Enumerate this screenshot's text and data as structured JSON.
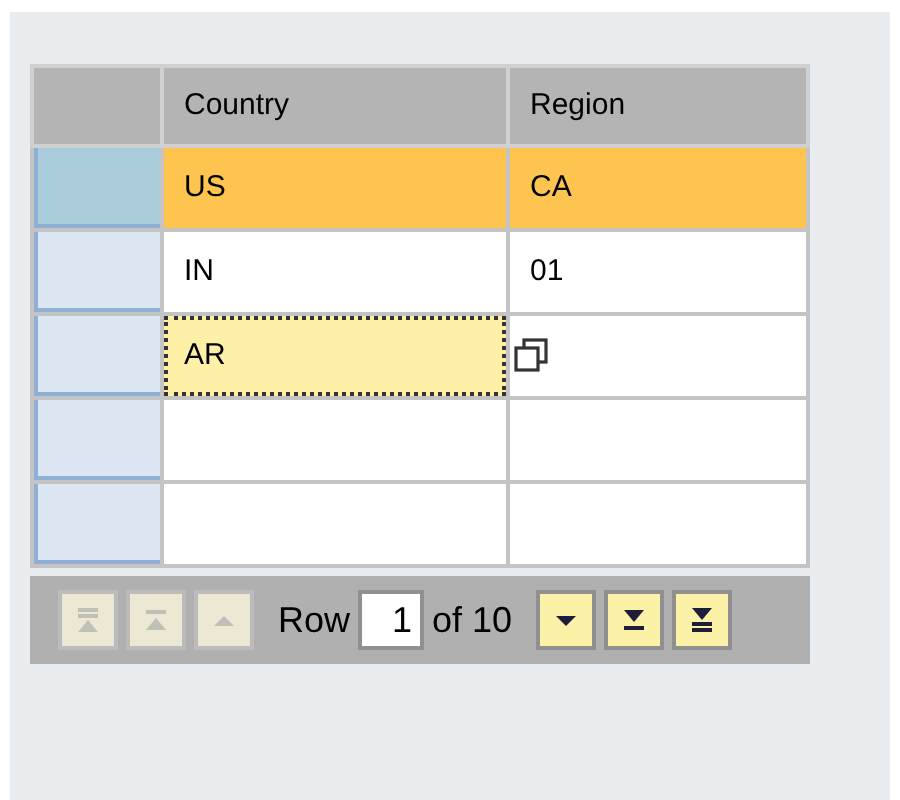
{
  "table": {
    "columns": [
      "Country",
      "Region"
    ],
    "rows": [
      {
        "selected": true,
        "country": "US",
        "region": "CA"
      },
      {
        "selected": false,
        "country": "IN",
        "region": "01"
      },
      {
        "selected": false,
        "country": "AR",
        "country_focused": true,
        "region_value_help": true
      },
      {
        "selected": false
      },
      {
        "selected": false
      }
    ]
  },
  "pager": {
    "label": "Row",
    "value": "1",
    "total": "of 10",
    "buttons": [
      {
        "kind": "first",
        "disabled": true
      },
      {
        "kind": "page-up",
        "disabled": true
      },
      {
        "kind": "up",
        "disabled": true
      },
      {
        "kind": "down",
        "disabled": false
      },
      {
        "kind": "page-down",
        "disabled": false
      },
      {
        "kind": "last",
        "disabled": false
      }
    ]
  }
}
